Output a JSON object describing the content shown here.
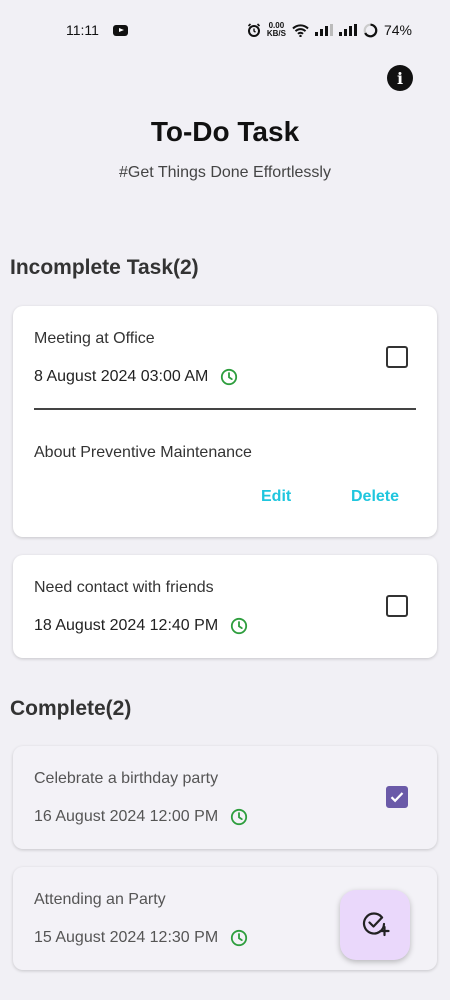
{
  "status_bar": {
    "time": "11:11",
    "net_speed_value": "0.00",
    "net_speed_unit": "KB/S",
    "battery": "74%",
    "icons": [
      "youtube-icon",
      "alarm-icon",
      "wifi-icon",
      "signal-icon",
      "battery-icon"
    ]
  },
  "header": {
    "title": "To-Do Task",
    "subtitle": "#Get Things Done Effortlessly",
    "info_glyph": "i"
  },
  "incomplete": {
    "heading": "Incomplete Task(2)",
    "tasks": [
      {
        "title": "Meeting at Office",
        "datetime": "8 August 2024 03:00 AM",
        "description": "About Preventive Maintenance",
        "edit_label": "Edit",
        "delete_label": "Delete",
        "checked": false
      },
      {
        "title": "Need contact with friends",
        "datetime": "18 August 2024 12:40 PM",
        "checked": false
      }
    ]
  },
  "complete": {
    "heading": "Complete(2)",
    "tasks": [
      {
        "title": "Celebrate a birthday party",
        "datetime": "16 August 2024 12:00 PM",
        "checked": true
      },
      {
        "title": "Attending an Party",
        "datetime": "15 August 2024 12:30 PM",
        "checked": true
      }
    ]
  },
  "colors": {
    "accent_link": "#1fc6de",
    "checkbox_checked": "#6a5aa8",
    "clock_icon": "#2e9e3e",
    "fab_background": "#ead8fb"
  }
}
